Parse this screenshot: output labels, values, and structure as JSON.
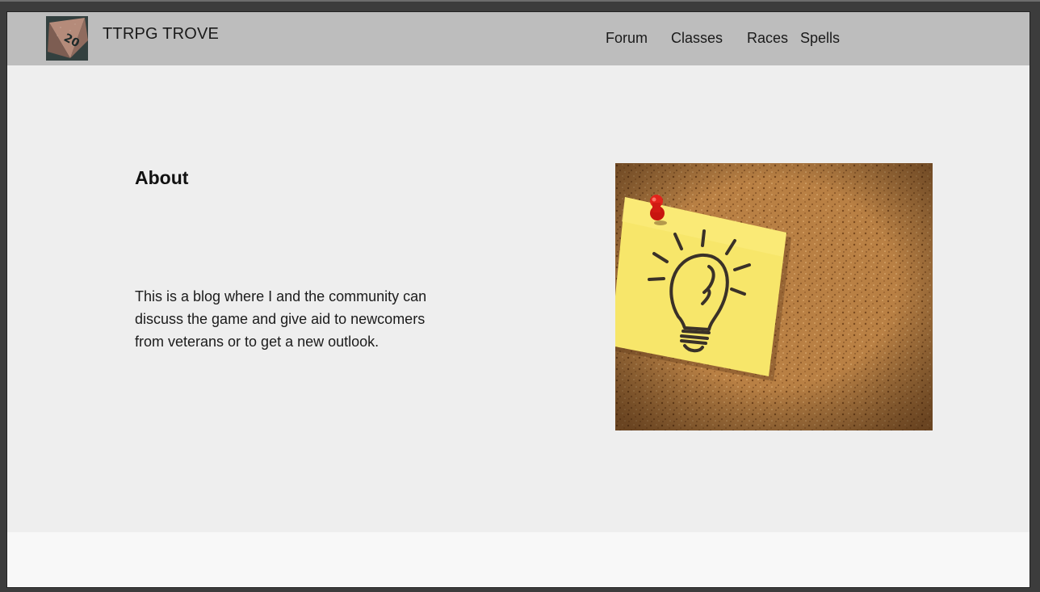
{
  "brand": {
    "name": "TTRPG TROVE",
    "logo_icon": "d20-dice-icon",
    "logo_number": "20"
  },
  "nav": {
    "items": [
      {
        "label": "Forum"
      },
      {
        "label": "Classes"
      },
      {
        "label": "Races"
      },
      {
        "label": "Spells"
      }
    ]
  },
  "about": {
    "title": "About",
    "text": "This is a blog where I and the community can discuss the game and give aid to newcomers from veterans or to get a new outlook."
  },
  "image": {
    "icon": "lightbulb-sticky-note-icon"
  },
  "colors": {
    "navbar": "#bdbdbd",
    "main_bg": "#eeeeee",
    "footer_bg": "#f8f8f8",
    "sticky_note": "#f7e66a",
    "pin": "#e0201a",
    "cork": "#b57a3f"
  }
}
